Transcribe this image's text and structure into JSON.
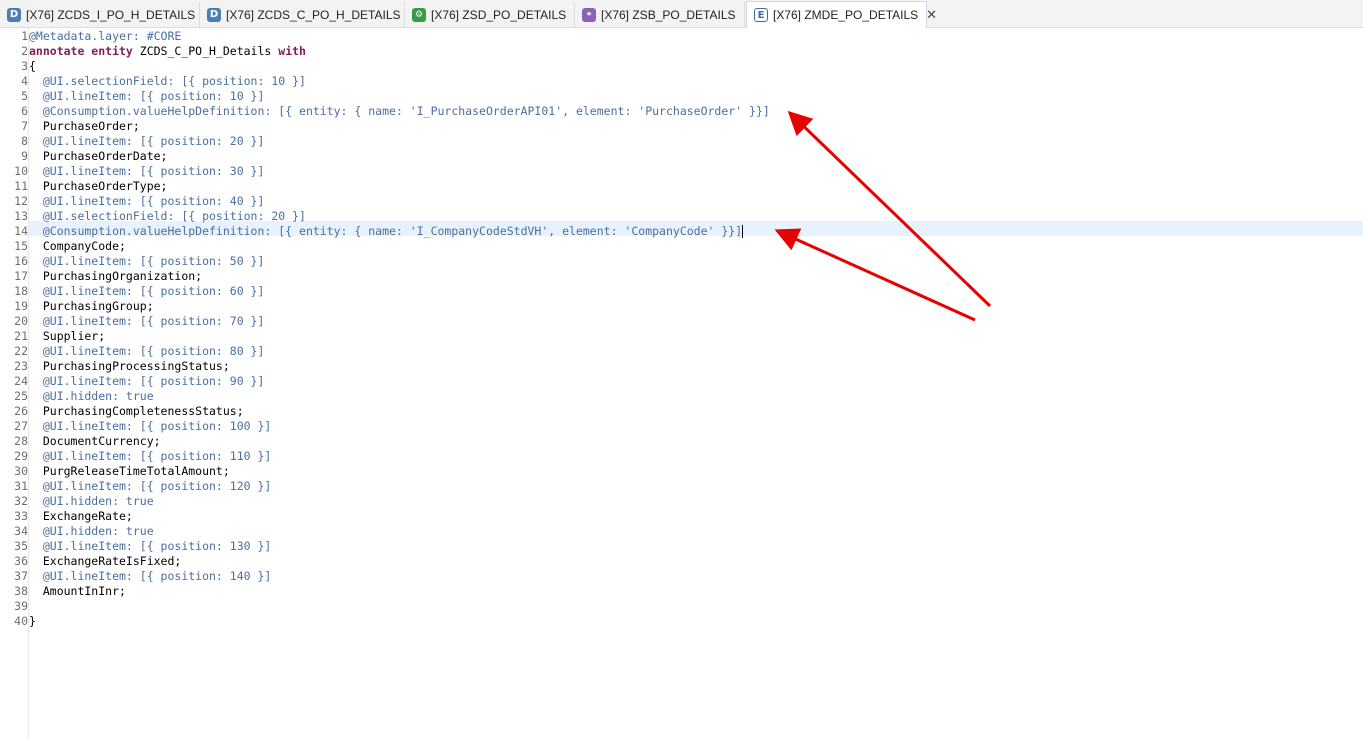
{
  "tabs": [
    {
      "icon": "D",
      "label": "[X76] ZCDS_I_PO_H_DETAILS",
      "active": false
    },
    {
      "icon": "D",
      "label": "[X76] ZCDS_C_PO_H_DETAILS",
      "active": false
    },
    {
      "icon": "S",
      "label": "[X76] ZSD_PO_DETAILS",
      "active": false
    },
    {
      "icon": "B",
      "label": "[X76] ZSB_PO_DETAILS",
      "active": false
    },
    {
      "icon": "E",
      "label": "[X76] ZMDE_PO_DETAILS",
      "active": true,
      "close": "✕"
    }
  ],
  "editor": {
    "current_line": 14,
    "lines": [
      {
        "n": "1",
        "text": "@Metadata.layer: #CORE"
      },
      {
        "n": "2",
        "text": "annotate entity ZCDS_C_PO_H_Details with"
      },
      {
        "n": "3",
        "text": "{"
      },
      {
        "n": "4",
        "text": "  @UI.selectionField: [{ position: 10 }]"
      },
      {
        "n": "5",
        "text": "  @UI.lineItem: [{ position: 10 }]"
      },
      {
        "n": "6",
        "text": "  @Consumption.valueHelpDefinition: [{ entity: { name: 'I_PurchaseOrderAPI01', element: 'PurchaseOrder' }}]"
      },
      {
        "n": "7",
        "text": "  PurchaseOrder;"
      },
      {
        "n": "8",
        "text": "  @UI.lineItem: [{ position: 20 }]"
      },
      {
        "n": "9",
        "text": "  PurchaseOrderDate;"
      },
      {
        "n": "10",
        "text": "  @UI.lineItem: [{ position: 30 }]"
      },
      {
        "n": "11",
        "text": "  PurchaseOrderType;"
      },
      {
        "n": "12",
        "text": "  @UI.lineItem: [{ position: 40 }]"
      },
      {
        "n": "13",
        "text": "  @UI.selectionField: [{ position: 20 }]"
      },
      {
        "n": "14",
        "text": "  @Consumption.valueHelpDefinition: [{ entity: { name: 'I_CompanyCodeStdVH', element: 'CompanyCode' }}]"
      },
      {
        "n": "15",
        "text": "  CompanyCode;"
      },
      {
        "n": "16",
        "text": "  @UI.lineItem: [{ position: 50 }]"
      },
      {
        "n": "17",
        "text": "  PurchasingOrganization;"
      },
      {
        "n": "18",
        "text": "  @UI.lineItem: [{ position: 60 }]"
      },
      {
        "n": "19",
        "text": "  PurchasingGroup;"
      },
      {
        "n": "20",
        "text": "  @UI.lineItem: [{ position: 70 }]"
      },
      {
        "n": "21",
        "text": "  Supplier;"
      },
      {
        "n": "22",
        "text": "  @UI.lineItem: [{ position: 80 }]"
      },
      {
        "n": "23",
        "text": "  PurchasingProcessingStatus;"
      },
      {
        "n": "24",
        "text": "  @UI.lineItem: [{ position: 90 }]"
      },
      {
        "n": "25",
        "text": "  @UI.hidden: true"
      },
      {
        "n": "26",
        "text": "  PurchasingCompletenessStatus;"
      },
      {
        "n": "27",
        "text": "  @UI.lineItem: [{ position: 100 }]"
      },
      {
        "n": "28",
        "text": "  DocumentCurrency;"
      },
      {
        "n": "29",
        "text": "  @UI.lineItem: [{ position: 110 }]"
      },
      {
        "n": "30",
        "text": "  PurgReleaseTimeTotalAmount;"
      },
      {
        "n": "31",
        "text": "  @UI.lineItem: [{ position: 120 }]"
      },
      {
        "n": "32",
        "text": "  @UI.hidden: true"
      },
      {
        "n": "33",
        "text": "  ExchangeRate;"
      },
      {
        "n": "34",
        "text": "  @UI.hidden: true"
      },
      {
        "n": "35",
        "text": "  @UI.lineItem: [{ position: 130 }]"
      },
      {
        "n": "36",
        "text": "  ExchangeRateIsFixed;"
      },
      {
        "n": "37",
        "text": "  @UI.lineItem: [{ position: 140 }]"
      },
      {
        "n": "38",
        "text": "  AmountInInr;"
      },
      {
        "n": "39",
        "text": ""
      },
      {
        "n": "40",
        "text": "}"
      }
    ]
  },
  "annotation_color": "#e60000"
}
